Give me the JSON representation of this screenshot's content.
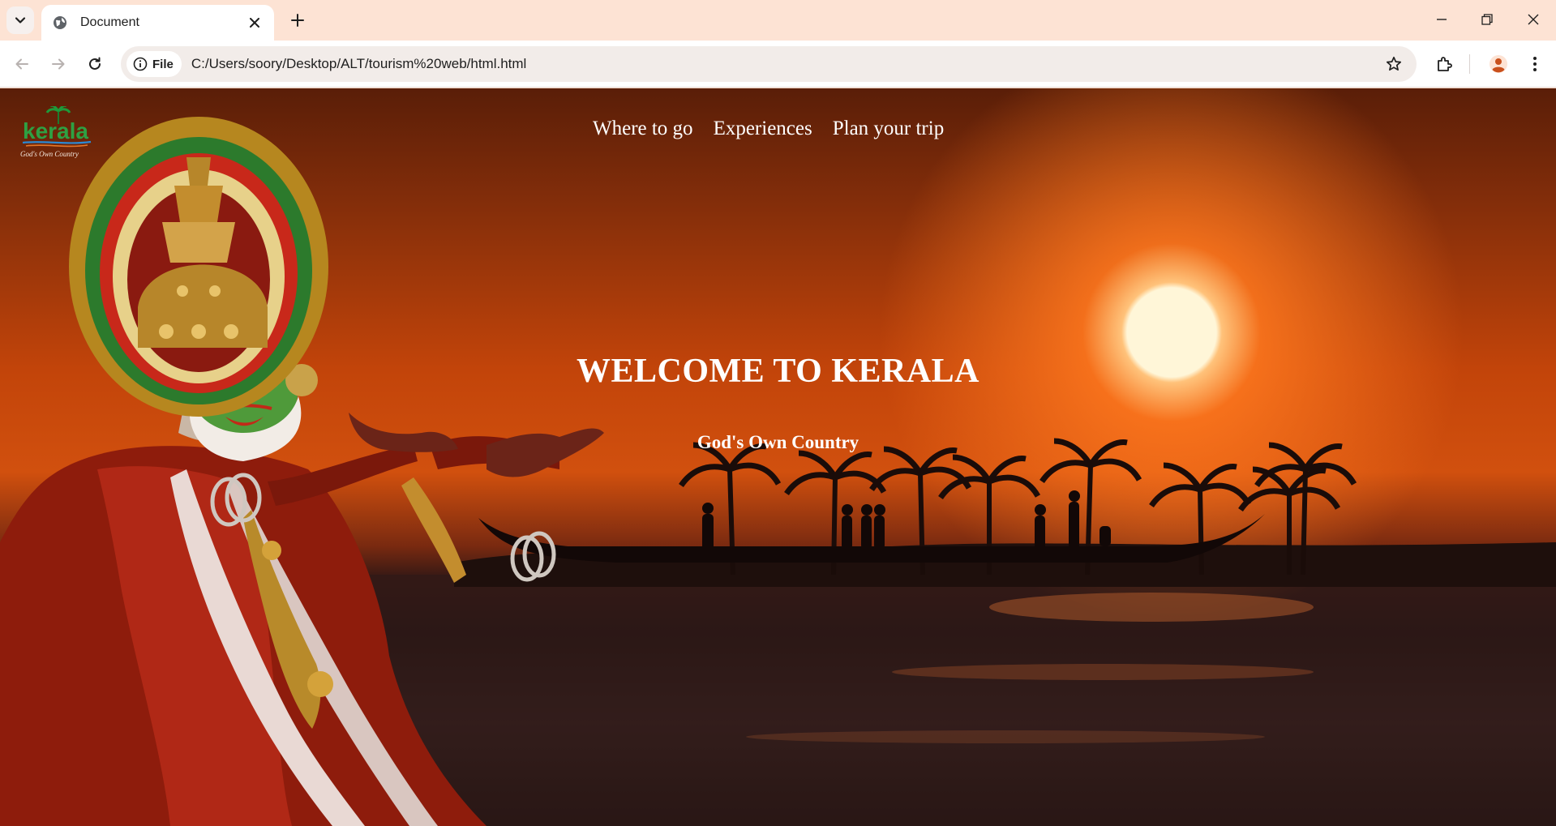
{
  "browser": {
    "tab_title": "Document",
    "omnibox_chip": "File",
    "url": "C:/Users/soory/Desktop/ALT/tourism%20web/html.html",
    "accent": "#fde3d4",
    "profile_color": "#c9501c"
  },
  "page": {
    "logo_text": "kerala",
    "logo_tagline": "God's Own Country",
    "nav": [
      "Where to go",
      "Experiences",
      "Plan your trip"
    ],
    "heading": "WELCOME TO KERALA",
    "subheading": "God's Own Country"
  }
}
